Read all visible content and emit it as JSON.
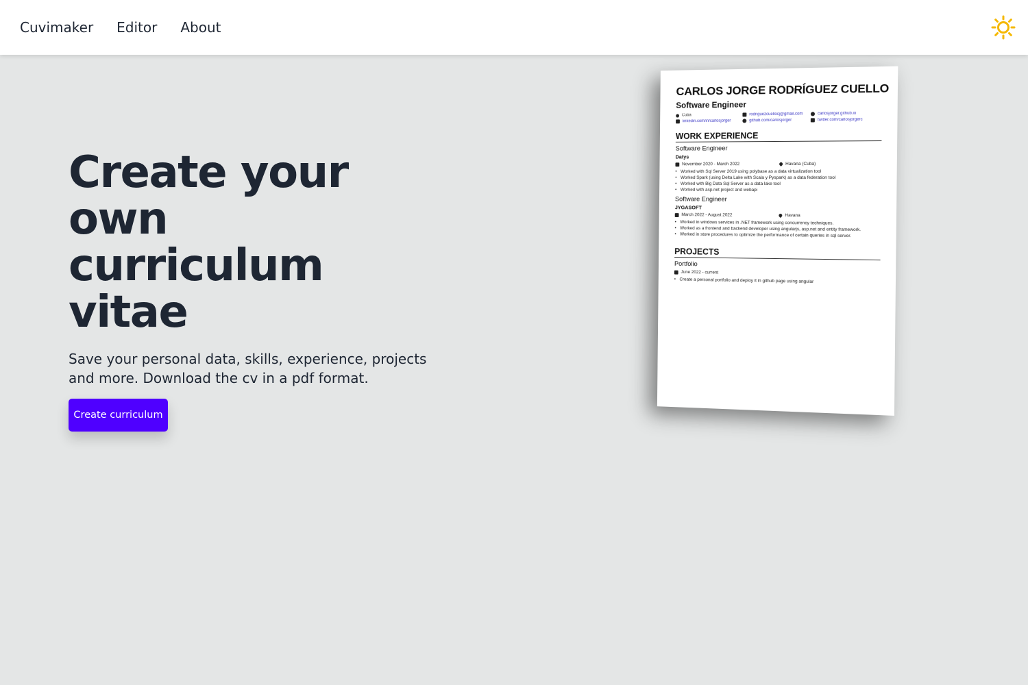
{
  "nav": {
    "items": [
      {
        "label": "Cuvimaker"
      },
      {
        "label": "Editor"
      },
      {
        "label": "About"
      }
    ],
    "theme_icon": "sun-icon",
    "theme_color": "#f5b800"
  },
  "hero": {
    "title_line1": "Create your own",
    "title_line2": "curriculum vitae",
    "subtitle": "Save your personal data, skills, experience, projects and more. Download the cv in a pdf format.",
    "cta_label": "Create curriculum",
    "cta_color": "#4f00ff"
  },
  "cv": {
    "name": "CARLOS JORGE RODRÍGUEZ CUELLO",
    "role": "Software Engineer",
    "contacts": [
      {
        "icon": "location-icon",
        "text": "Cuba"
      },
      {
        "icon": "mail-icon",
        "text": "rodriguezcuellocj@gmail.com"
      },
      {
        "icon": "user-icon",
        "text": "carlosjorger.github.io"
      },
      {
        "icon": "linkedin-icon",
        "text": "linkedin.com/in/carlosjorger"
      },
      {
        "icon": "github-icon",
        "text": "github.com/carlosjorger"
      },
      {
        "icon": "twitter-icon",
        "text": "twitter.com/carlosjorgerc"
      }
    ],
    "work_heading": "WORK EXPERIENCE",
    "jobs": [
      {
        "title": "Software Engineer",
        "company": "Datys",
        "dates": "November 2020 - March 2022",
        "location": "Havana (Cuba)",
        "bullets": [
          "Worked with Sql Server 2019 using polybase as a data virtualization tool",
          "Worked Spark (using Delta Lake with Scala y Pyspark) as a data federation tool",
          "Worked with Big Data Sql Server as a data lake tool",
          "Worked with asp.net project and webapi"
        ]
      },
      {
        "title": "Software Engineer",
        "company": "JYGASOFT",
        "dates": "March 2022 - August 2022",
        "location": "Havana",
        "bullets": [
          "Worked in windows services in .NET framework using concurrency techniques.",
          "Worked as a frontend and backend developer using angularjs, asp.net and entity framework.",
          "Worked in store procedures to optimize the performance of certain queries in sql server."
        ]
      }
    ],
    "projects_heading": "PROJECTS",
    "projects": [
      {
        "title": "Portfolio",
        "dates": "June 2022 - current",
        "bullets": [
          "Create a personal portfolio and deploy it in github page using angular"
        ]
      }
    ]
  }
}
